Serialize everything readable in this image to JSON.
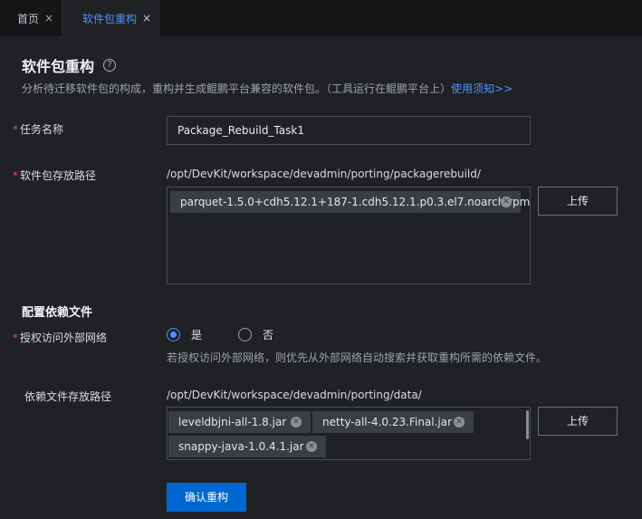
{
  "tabs": [
    {
      "label": "首页",
      "close": "×"
    },
    {
      "label": "软件包重构",
      "close": "×"
    }
  ],
  "page": {
    "title": "软件包重构",
    "help": "?",
    "subtitle": "分析待迁移软件包的构成，重构并生成鲲鹏平台兼容的软件包。（工具运行在鲲鹏平台上）",
    "subtitle_link": "使用须知>>"
  },
  "form": {
    "required_mark": "*",
    "task_name_label": "任务名称",
    "task_name_value": "Package_Rebuild_Task1",
    "pkg_path_label": "软件包存放路径",
    "pkg_path_value": "/opt/DevKit/workspace/devadmin/porting/packagerebuild/",
    "pkg_files": [
      "parquet-1.5.0+cdh5.12.1+187-1.cdh5.12.1.p0.3.el7.noarch.rpm"
    ],
    "upload_label": "上传",
    "dep_section_title": "配置依赖文件",
    "auth_label": "授权访问外部网络",
    "auth_yes": "是",
    "auth_no": "否",
    "auth_selected": "是",
    "auth_hint": "若授权访问外部网络，则优先从外部网络自动搜索并获取重构所需的依赖文件。",
    "dep_path_label": "依赖文件存放路径",
    "dep_path_value": "/opt/DevKit/workspace/devadmin/porting/data/",
    "dep_files": [
      "leveldbjni-all-1.8.jar",
      "netty-all-4.0.23.Final.jar",
      "snappy-java-1.0.4.1.jar"
    ],
    "confirm_label": "确认重构"
  },
  "colors": {
    "accent": "#4f93ff",
    "primary_button": "#0067d1",
    "required": "#f04b4b",
    "background": "#1f2124"
  }
}
